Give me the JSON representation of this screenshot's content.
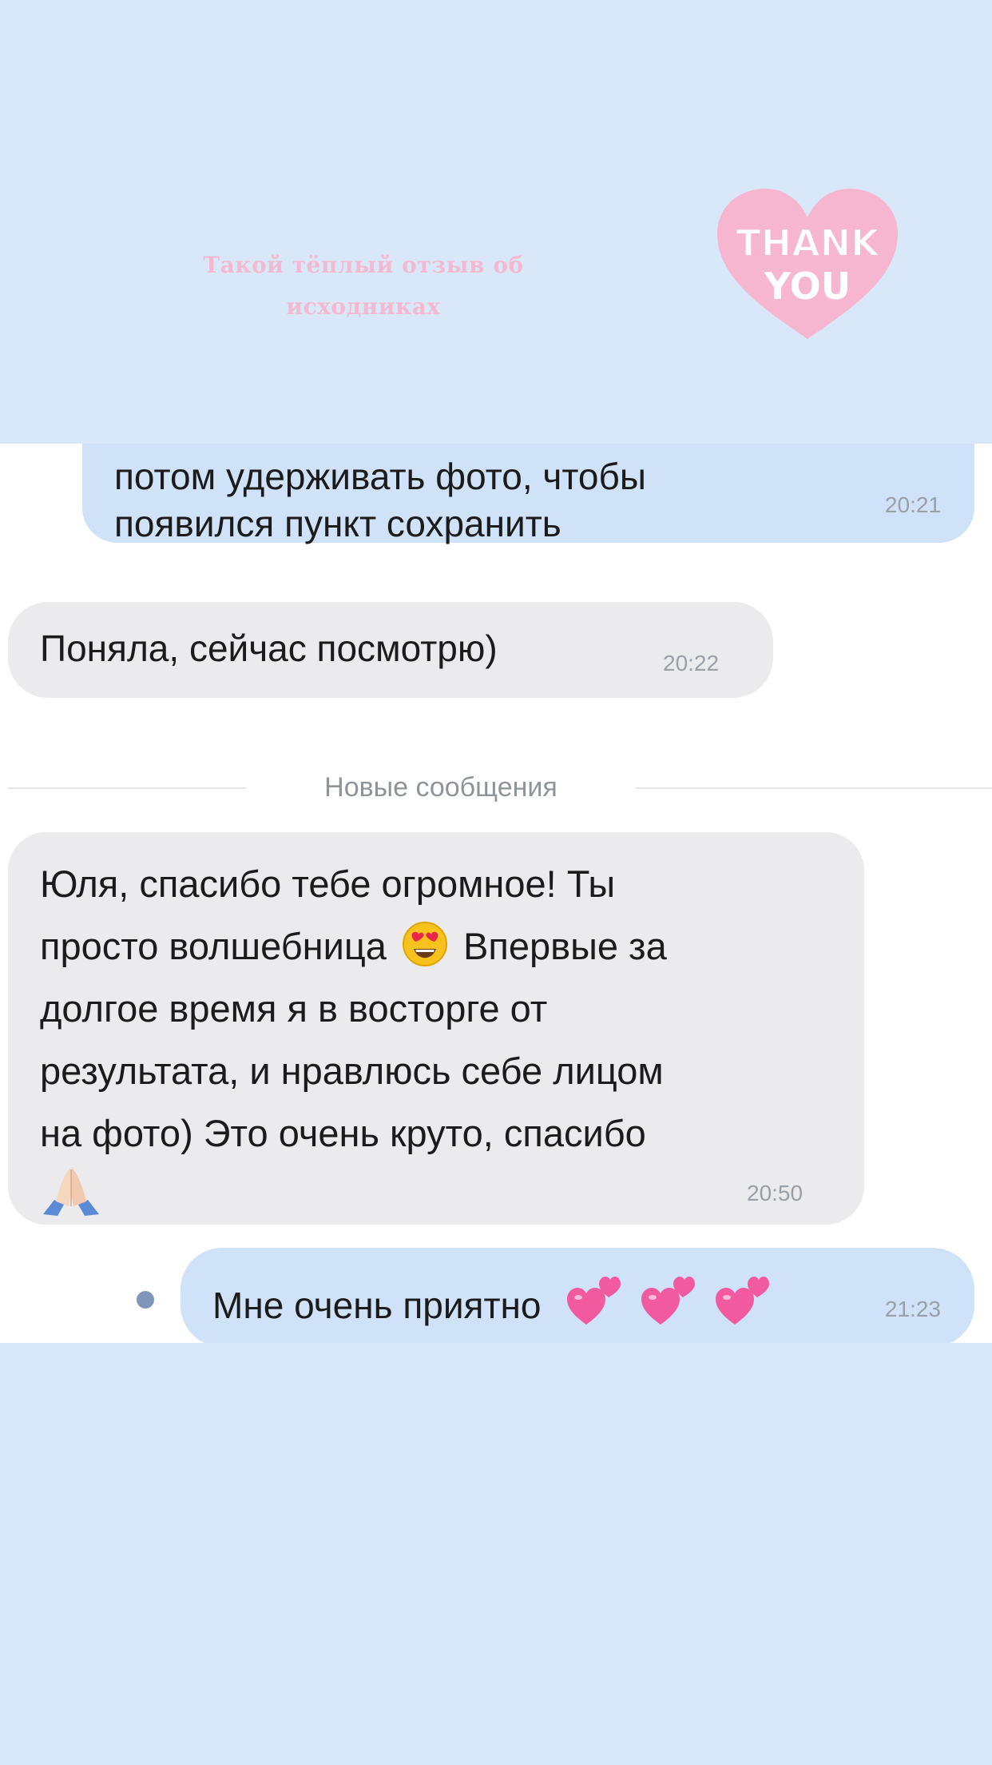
{
  "story": {
    "caption_line1": "Такой тёплый отзыв об",
    "caption_line2": "исходниках",
    "sticker": {
      "line1": "THANK",
      "line2": "YOU",
      "color": "#f6b6cf"
    }
  },
  "chat": {
    "messages": [
      {
        "direction": "outgoing",
        "line1": "потом удерживать фото, чтобы",
        "line2": "появился пункт сохранить",
        "time": "20:21"
      },
      {
        "direction": "incoming",
        "text": "Поняла, сейчас посмотрю)",
        "time": "20:22"
      },
      {
        "direction": "incoming",
        "line1": "Юля, спасибо тебе огромное! Ты",
        "line2a": "просто волшебница",
        "line2b": "Впервые за",
        "line3": "долгое время я в восторге от",
        "line4": "результата, и нравлюсь себе лицом",
        "line5": "на фото) Это очень круто, спасибо",
        "emoji_inline": "heart-eyes-emoji",
        "emoji_end": "folded-hands-emoji",
        "time": "20:50"
      },
      {
        "direction": "outgoing",
        "text": "Мне очень приятно",
        "emoji": "two-hearts-emoji",
        "emoji_count": 3,
        "time": "21:23",
        "unread_dot": true
      }
    ],
    "divider": "Новые сообщения"
  },
  "colors": {
    "background": "#d9e8f9",
    "outgoing_bubble": "#cfe2f8",
    "incoming_bubble": "#ebebed",
    "caption": "#f4b9d0",
    "unread_dot": "#7f95b9"
  }
}
